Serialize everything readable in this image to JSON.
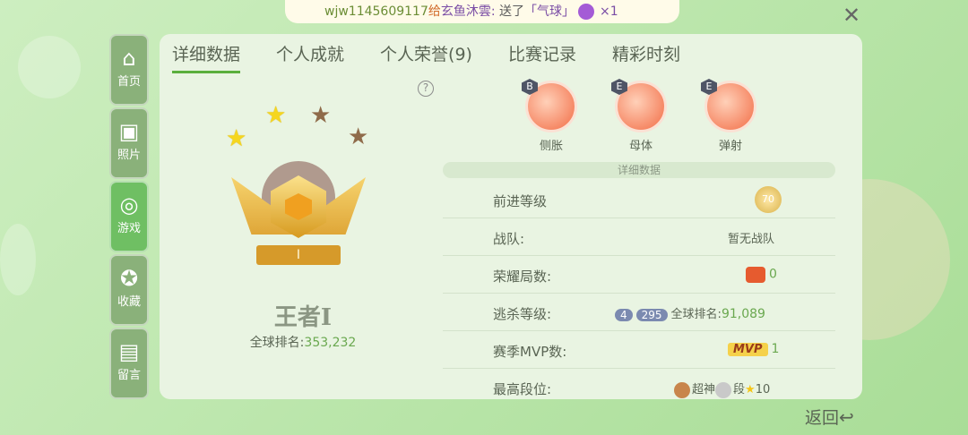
{
  "banner": {
    "user": "wjw1145609117",
    "give": "给",
    "recipient": "玄鱼沐雲:",
    "sent": "送了",
    "gift": "「气球」",
    "count": "×1"
  },
  "close_label": "✕",
  "nav": [
    {
      "label": "首页",
      "icon": "home-icon",
      "glyph": "⌂"
    },
    {
      "label": "照片",
      "icon": "photo-icon",
      "glyph": "▣"
    },
    {
      "label": "游戏",
      "icon": "gamepad-icon",
      "glyph": "◎"
    },
    {
      "label": "收藏",
      "icon": "favorite-icon",
      "glyph": "✪"
    },
    {
      "label": "留言",
      "icon": "message-icon",
      "glyph": "▤"
    }
  ],
  "tabs": [
    "详细数据",
    "个人成就",
    "个人荣誉(9)",
    "比赛记录",
    "精彩时刻"
  ],
  "help_label": "?",
  "rank": {
    "name": "王者Ⅰ",
    "plate": "Ⅰ",
    "global_label": "全球排名:",
    "global_value": "353,232"
  },
  "skills": [
    {
      "name": "侧胀",
      "grade": "B"
    },
    {
      "name": "母体",
      "grade": "E"
    },
    {
      "name": "弹射",
      "grade": "E"
    }
  ],
  "details_title": "详细数据",
  "details": {
    "advance_label": "前进等级",
    "advance_medal": "70",
    "team_label": "战队:",
    "team_value": "暂无战队",
    "glory_label": "荣耀局数:",
    "glory_value": "0",
    "escape_label": "逃杀等级:",
    "escape_level": "4",
    "escape_points": "295",
    "escape_rank_label": "全球排名:",
    "escape_rank_value": "91,089",
    "mvp_label": "赛季MVP数:",
    "mvp_badge": "MVP",
    "mvp_value": "1",
    "highest_label": "最高段位:",
    "highest_tier": "超神",
    "highest_tier2": "段",
    "highest_stars": "10"
  },
  "back_label": "返回",
  "colors": {
    "accent_green": "#6aa84f",
    "active_tab_underline": "#5aaf3c",
    "nav_active": "#6fbf63"
  }
}
